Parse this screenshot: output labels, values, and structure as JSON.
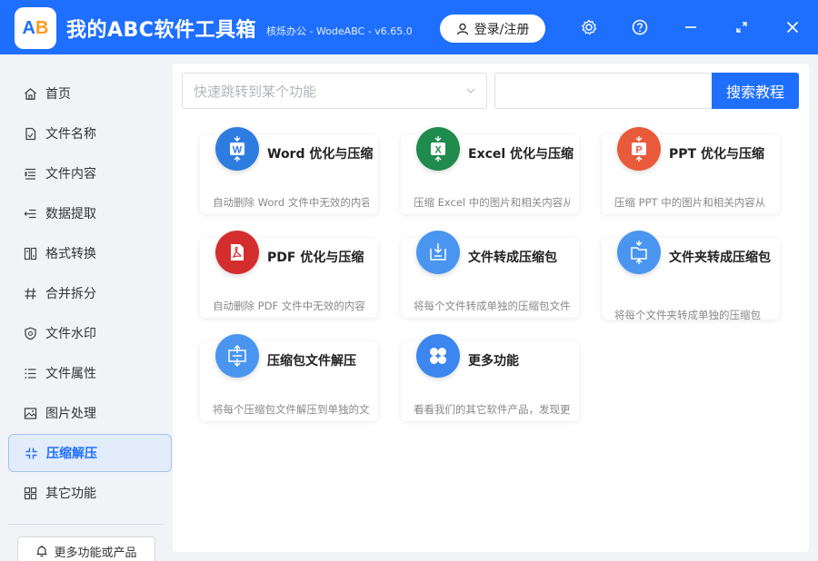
{
  "app": {
    "logo_text_a": "A",
    "logo_text_b": "B",
    "title": "我的ABC软件工具箱",
    "subtitle": "核烁办公 - WodeABC - v6.65.0",
    "login_label": "登录/注册"
  },
  "sidebar": {
    "items": [
      {
        "label": "首页",
        "icon": "home-icon"
      },
      {
        "label": "文件名称",
        "icon": "file-name-icon"
      },
      {
        "label": "文件内容",
        "icon": "file-content-icon"
      },
      {
        "label": "数据提取",
        "icon": "data-extract-icon"
      },
      {
        "label": "格式转换",
        "icon": "format-convert-icon"
      },
      {
        "label": "合并拆分",
        "icon": "merge-split-icon"
      },
      {
        "label": "文件水印",
        "icon": "watermark-icon"
      },
      {
        "label": "文件属性",
        "icon": "file-attr-icon"
      },
      {
        "label": "图片处理",
        "icon": "image-icon"
      },
      {
        "label": "压缩解压",
        "icon": "compress-icon",
        "active": true
      },
      {
        "label": "其它功能",
        "icon": "other-icon"
      }
    ],
    "more_products_label": "更多功能或产品"
  },
  "toolbar": {
    "jump_placeholder": "快速跳转到某个功能",
    "search_value": "",
    "search_label": "搜索教程"
  },
  "cards": [
    {
      "title": "Word 优化与压缩",
      "desc": "自动删除 Word 文件中无效的内容",
      "icon": "word-icon",
      "color": "#2f7ce0"
    },
    {
      "title": "Excel 优化与压缩",
      "desc": "压缩 Excel 中的图片和相关内容从",
      "icon": "excel-icon",
      "color": "#1f8b4c"
    },
    {
      "title": "PPT 优化与压缩",
      "desc": "压缩 PPT 中的图片和相关内容从",
      "icon": "ppt-icon",
      "color": "#e85a3a"
    },
    {
      "title": "PDF 优化与压缩",
      "desc": "自动删除 PDF 文件中无效的内容",
      "icon": "pdf-icon",
      "color": "#d42d2d"
    },
    {
      "title": "文件转成压缩包",
      "desc": "将每个文件转成单独的压缩包文件",
      "icon": "file-to-zip-icon",
      "color": "#4a95f0"
    },
    {
      "title": "文件夹转成压缩包",
      "desc": "将每个文件夹转成单独的压缩包",
      "icon": "folder-to-zip-icon",
      "color": "#4a95f0"
    },
    {
      "title": "压缩包文件解压",
      "desc": "将每个压缩包文件解压到单独的文",
      "icon": "unzip-icon",
      "color": "#4a95f0"
    },
    {
      "title": "更多功能",
      "desc": "看看我们的其它软件产品，发现更多",
      "icon": "more-icon",
      "color": "#3b86ef"
    }
  ]
}
